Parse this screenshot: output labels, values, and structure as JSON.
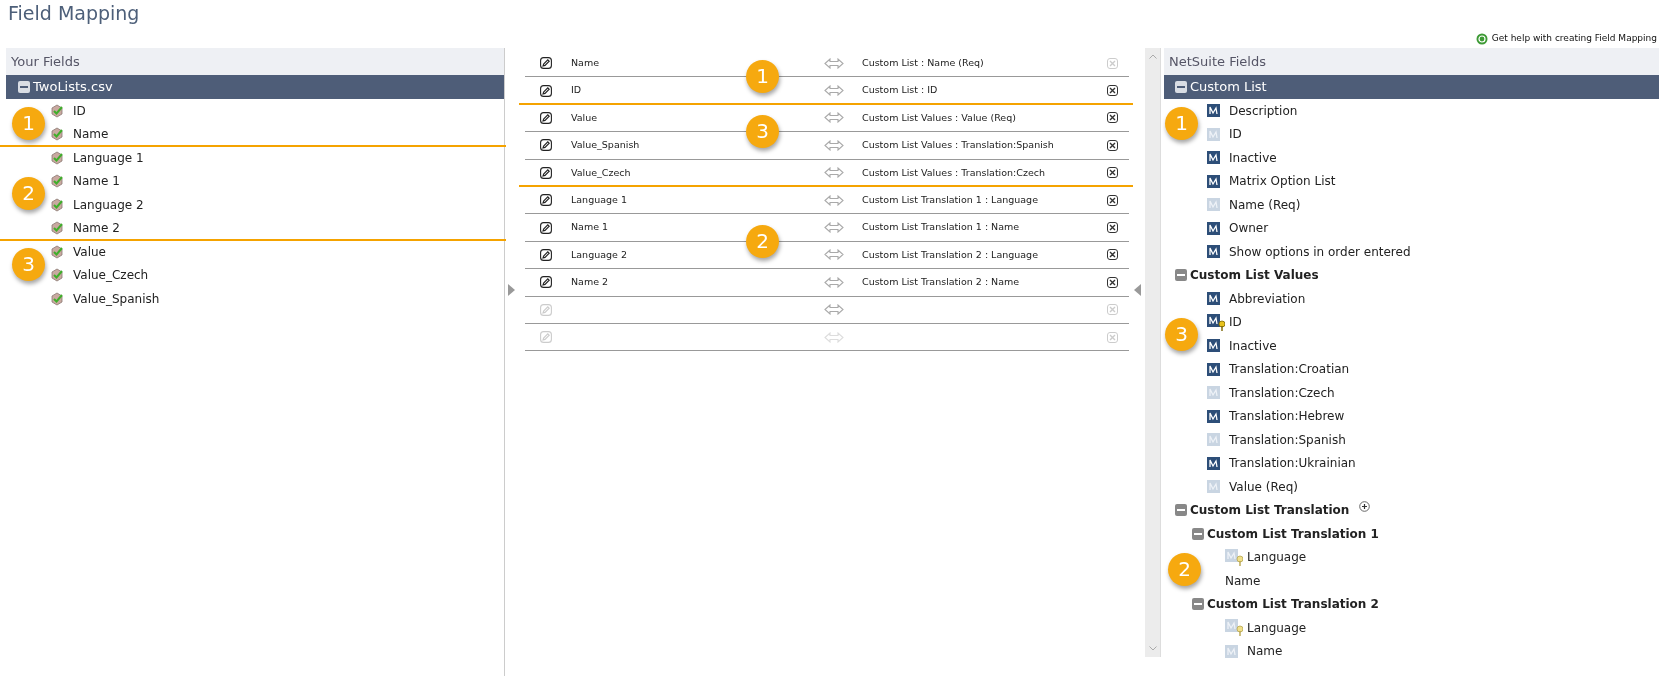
{
  "title": "Field Mapping",
  "help_link": "Get help with creating Field Mapping",
  "your_fields": {
    "heading": "Your Fields",
    "file": {
      "label": "TwoLists.csv",
      "expanded": true,
      "selected": true
    },
    "items": [
      {
        "label": "ID",
        "callout": "1",
        "callout_line": false
      },
      {
        "label": "Name",
        "callout_line": true
      },
      {
        "label": "Language 1",
        "callout_line": false
      },
      {
        "label": "Name 1",
        "callout": "2",
        "callout_line": false
      },
      {
        "label": "Language 2",
        "callout_line": false
      },
      {
        "label": "Name 2",
        "callout_line": true
      },
      {
        "label": "Value",
        "callout": "3",
        "callout_line": false
      },
      {
        "label": "Value_Czech",
        "callout_line": false
      },
      {
        "label": "Value_Spanish",
        "callout_line": false
      }
    ]
  },
  "mappings": [
    {
      "source": "Name",
      "target": "Custom List : Name (Req)",
      "callout": "1",
      "editable": true,
      "removable": false,
      "arrow_active": true,
      "callout_line": false
    },
    {
      "source": "ID",
      "target": "Custom List : ID",
      "editable": true,
      "removable": true,
      "arrow_active": true,
      "callout_line": true
    },
    {
      "source": "Value",
      "target": "Custom List Values : Value (Req)",
      "callout": "3",
      "editable": true,
      "removable": true,
      "arrow_active": true,
      "callout_line": false
    },
    {
      "source": "Value_Spanish",
      "target": "Custom List Values : Translation:Spanish",
      "editable": true,
      "removable": true,
      "arrow_active": true,
      "callout_line": false
    },
    {
      "source": "Value_Czech",
      "target": "Custom List Values : Translation:Czech",
      "editable": true,
      "removable": true,
      "arrow_active": true,
      "callout_line": true
    },
    {
      "source": "Language 1",
      "target": "Custom List Translation 1 : Language",
      "editable": true,
      "removable": true,
      "arrow_active": true,
      "callout_line": false
    },
    {
      "source": "Name 1",
      "target": "Custom List Translation 1 : Name",
      "callout": "2",
      "editable": true,
      "removable": true,
      "arrow_active": true,
      "callout_line": false
    },
    {
      "source": "Language 2",
      "target": "Custom List Translation 2 : Language",
      "editable": true,
      "removable": true,
      "arrow_active": true,
      "callout_line": false
    },
    {
      "source": "Name 2",
      "target": "Custom List Translation 2 : Name",
      "editable": true,
      "removable": true,
      "arrow_active": true,
      "callout_line": false
    },
    {
      "editable": false,
      "removable": false,
      "arrow_active": true,
      "callout_line": false
    },
    {
      "editable": false,
      "removable": false,
      "arrow_active": false,
      "callout_line": false
    }
  ],
  "netsuite_fields": {
    "heading": "NetSuite Fields",
    "groups": [
      {
        "label": "Custom List",
        "expanded": true,
        "selected": true,
        "addable": false,
        "fields": [
          {
            "label": "Description",
            "kind": "field",
            "mapped": false,
            "key": false,
            "callout": "1"
          },
          {
            "label": "ID",
            "kind": "field",
            "mapped": true,
            "key": false
          },
          {
            "label": "Inactive",
            "kind": "field",
            "mapped": false,
            "key": false
          },
          {
            "label": "Matrix Option List",
            "kind": "field",
            "mapped": false,
            "key": false
          },
          {
            "label": "Name (Req)",
            "kind": "field",
            "mapped": true,
            "key": false
          },
          {
            "label": "Owner",
            "kind": "field",
            "mapped": false,
            "key": false
          },
          {
            "label": "Show options in order entered",
            "kind": "field",
            "mapped": false,
            "key": false
          }
        ]
      },
      {
        "label": "Custom List Values",
        "expanded": true,
        "selected": false,
        "addable": false,
        "fields": [
          {
            "label": "Abbreviation",
            "kind": "field",
            "mapped": false,
            "key": false
          },
          {
            "label": "ID",
            "kind": "field",
            "mapped": false,
            "key": true,
            "callout": "3"
          },
          {
            "label": "Inactive",
            "kind": "field",
            "mapped": false,
            "key": false
          },
          {
            "label": "Translation:Croatian",
            "kind": "field",
            "mapped": false,
            "key": false
          },
          {
            "label": "Translation:Czech",
            "kind": "field",
            "mapped": true,
            "key": false
          },
          {
            "label": "Translation:Hebrew",
            "kind": "field",
            "mapped": false,
            "key": false
          },
          {
            "label": "Translation:Spanish",
            "kind": "field",
            "mapped": true,
            "key": false
          },
          {
            "label": "Translation:Ukrainian",
            "kind": "field",
            "mapped": false,
            "key": false
          },
          {
            "label": "Value (Req)",
            "kind": "field",
            "mapped": true,
            "key": false
          }
        ]
      },
      {
        "label": "Custom List Translation",
        "expanded": true,
        "selected": false,
        "addable": true,
        "children": [
          {
            "label": "Custom List Translation 1",
            "expanded": true,
            "selected": false,
            "addable": false,
            "fields": [
              {
                "label": "Language",
                "kind": "field",
                "mapped": true,
                "key": true,
                "callout": "2"
              },
              {
                "label": "Name",
                "kind": "plain"
              }
            ]
          },
          {
            "label": "Custom List Translation 2",
            "expanded": true,
            "selected": false,
            "addable": false,
            "fields": [
              {
                "label": "Language",
                "kind": "field",
                "mapped": true,
                "key": true
              },
              {
                "label": "Name",
                "kind": "field",
                "mapped": true,
                "key": false
              }
            ]
          }
        ]
      }
    ]
  }
}
